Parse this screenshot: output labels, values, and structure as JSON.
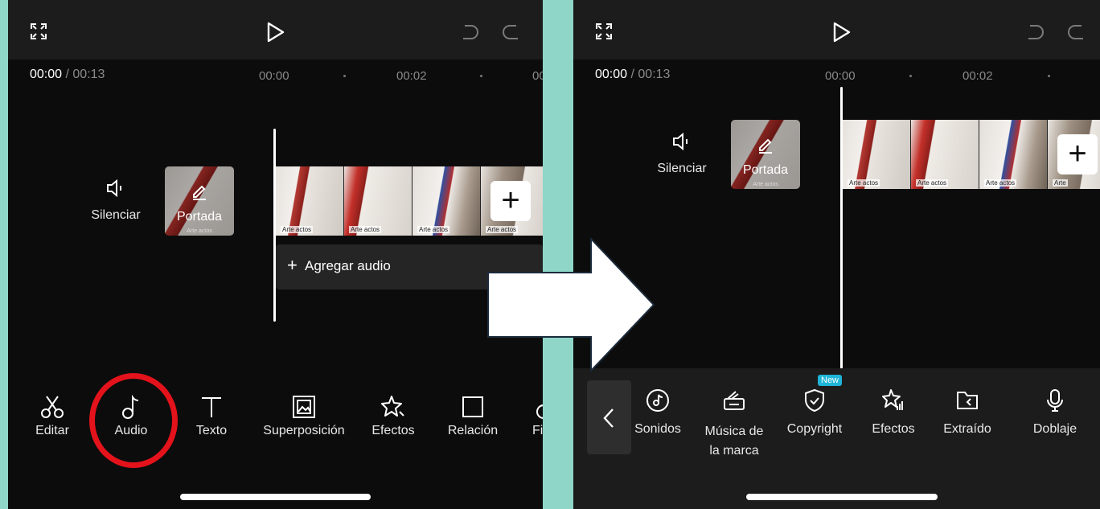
{
  "left": {
    "time": {
      "current": "00:00",
      "sep": "/",
      "total": "00:13"
    },
    "ruler": {
      "t0": "00:00",
      "t1": "00:02",
      "t2": "00"
    },
    "mute_label": "Silenciar",
    "cover_label": "Portada",
    "cover_caption": "Arte actos",
    "thumb_captions": [
      "Arte actos",
      "Arte actos",
      "Arte actos",
      "Arte actos"
    ],
    "add_audio": "Agregar audio",
    "add_audio_plus": "+",
    "clip_plus": "+",
    "tools": [
      "Editar",
      "Audio",
      "Texto",
      "Superposición",
      "Efectos",
      "Relación",
      "Fi"
    ],
    "highlight_color": "#e4121b"
  },
  "right": {
    "time": {
      "current": "00:00",
      "sep": "/",
      "total": "00:13"
    },
    "ruler": {
      "t0": "00:00",
      "t1": "00:02"
    },
    "mute_label": "Silenciar",
    "cover_label": "Portada",
    "cover_caption": "Arte actos",
    "thumb_captions": [
      "Arte actos",
      "Arte actos",
      "Arte actos",
      "Arte"
    ],
    "clip_plus": "+",
    "audio_tools": [
      "Sonidos",
      "Música de la marca",
      "Copyright",
      "Efectos",
      "Extraído",
      "Doblaje"
    ],
    "musica_line1": "Música de",
    "musica_line2": "la marca",
    "new_badge": "New"
  },
  "colors": {
    "background": "#8fd6c8",
    "panel": "#0c0c0c",
    "bar": "#1c1c1c",
    "badge": "#1fb5d8"
  }
}
